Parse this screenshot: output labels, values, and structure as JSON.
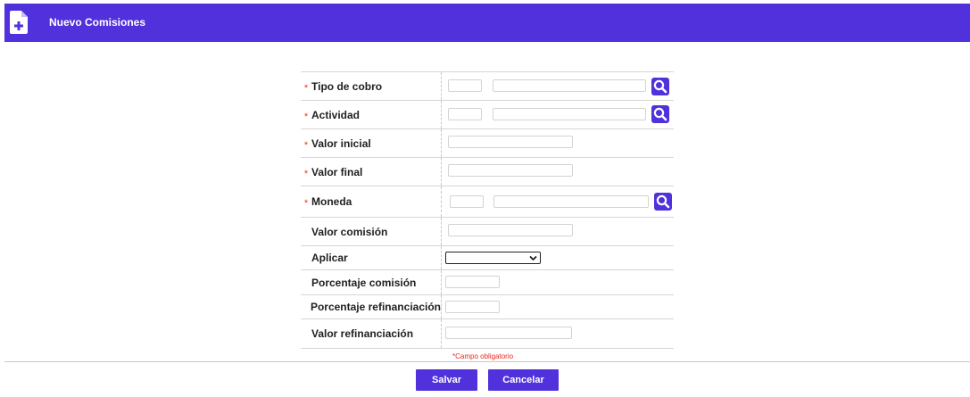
{
  "header": {
    "title": "Nuevo Comisiones",
    "icon": "file-plus-icon",
    "color": "#5031dc"
  },
  "form": {
    "fields": [
      {
        "label": "Tipo de cobro",
        "required": true,
        "type": "lookup"
      },
      {
        "label": "Actividad",
        "required": true,
        "type": "lookup"
      },
      {
        "label": "Valor inicial",
        "required": true,
        "type": "text"
      },
      {
        "label": "Valor final",
        "required": true,
        "type": "text"
      },
      {
        "label": "Moneda",
        "required": true,
        "type": "lookup"
      },
      {
        "label": "Valor comisión",
        "required": false,
        "type": "text"
      },
      {
        "label": "Aplicar",
        "required": false,
        "type": "select",
        "value": ""
      },
      {
        "label": "Porcentaje comisión",
        "required": false,
        "type": "text"
      },
      {
        "label": "Porcentaje refinanciación",
        "required": false,
        "type": "text"
      },
      {
        "label": "Valor refinanciación",
        "required": false,
        "type": "text"
      }
    ],
    "required_marker": "*",
    "required_note": "*Campo obligatorio"
  },
  "buttons": {
    "save": "Salvar",
    "cancel": "Cancelar"
  }
}
